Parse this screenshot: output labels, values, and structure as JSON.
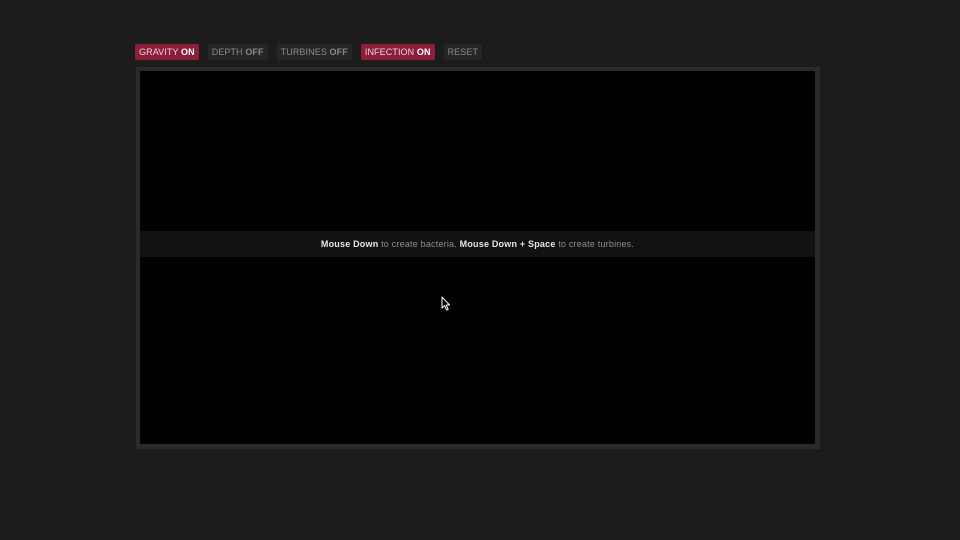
{
  "toolbar": {
    "buttons": [
      {
        "label": "GRAVITY",
        "state": "ON",
        "active": true
      },
      {
        "label": "DEPTH",
        "state": "OFF",
        "active": false
      },
      {
        "label": "TURBINES",
        "state": "OFF",
        "active": false
      },
      {
        "label": "INFECTION",
        "state": "ON",
        "active": true
      },
      {
        "label": "RESET",
        "state": "",
        "active": false
      }
    ]
  },
  "instructions": {
    "action1": "Mouse Down",
    "text1": "to create bacteria.",
    "action2": "Mouse Down + Space",
    "text2": "to create turbines."
  },
  "colors": {
    "page_background": "#1c1c1c",
    "canvas_background": "#000000",
    "active_button": "#8c1e3a",
    "inactive_button": "#262626"
  },
  "icons": {
    "cursor": "arrow-cursor-icon"
  }
}
